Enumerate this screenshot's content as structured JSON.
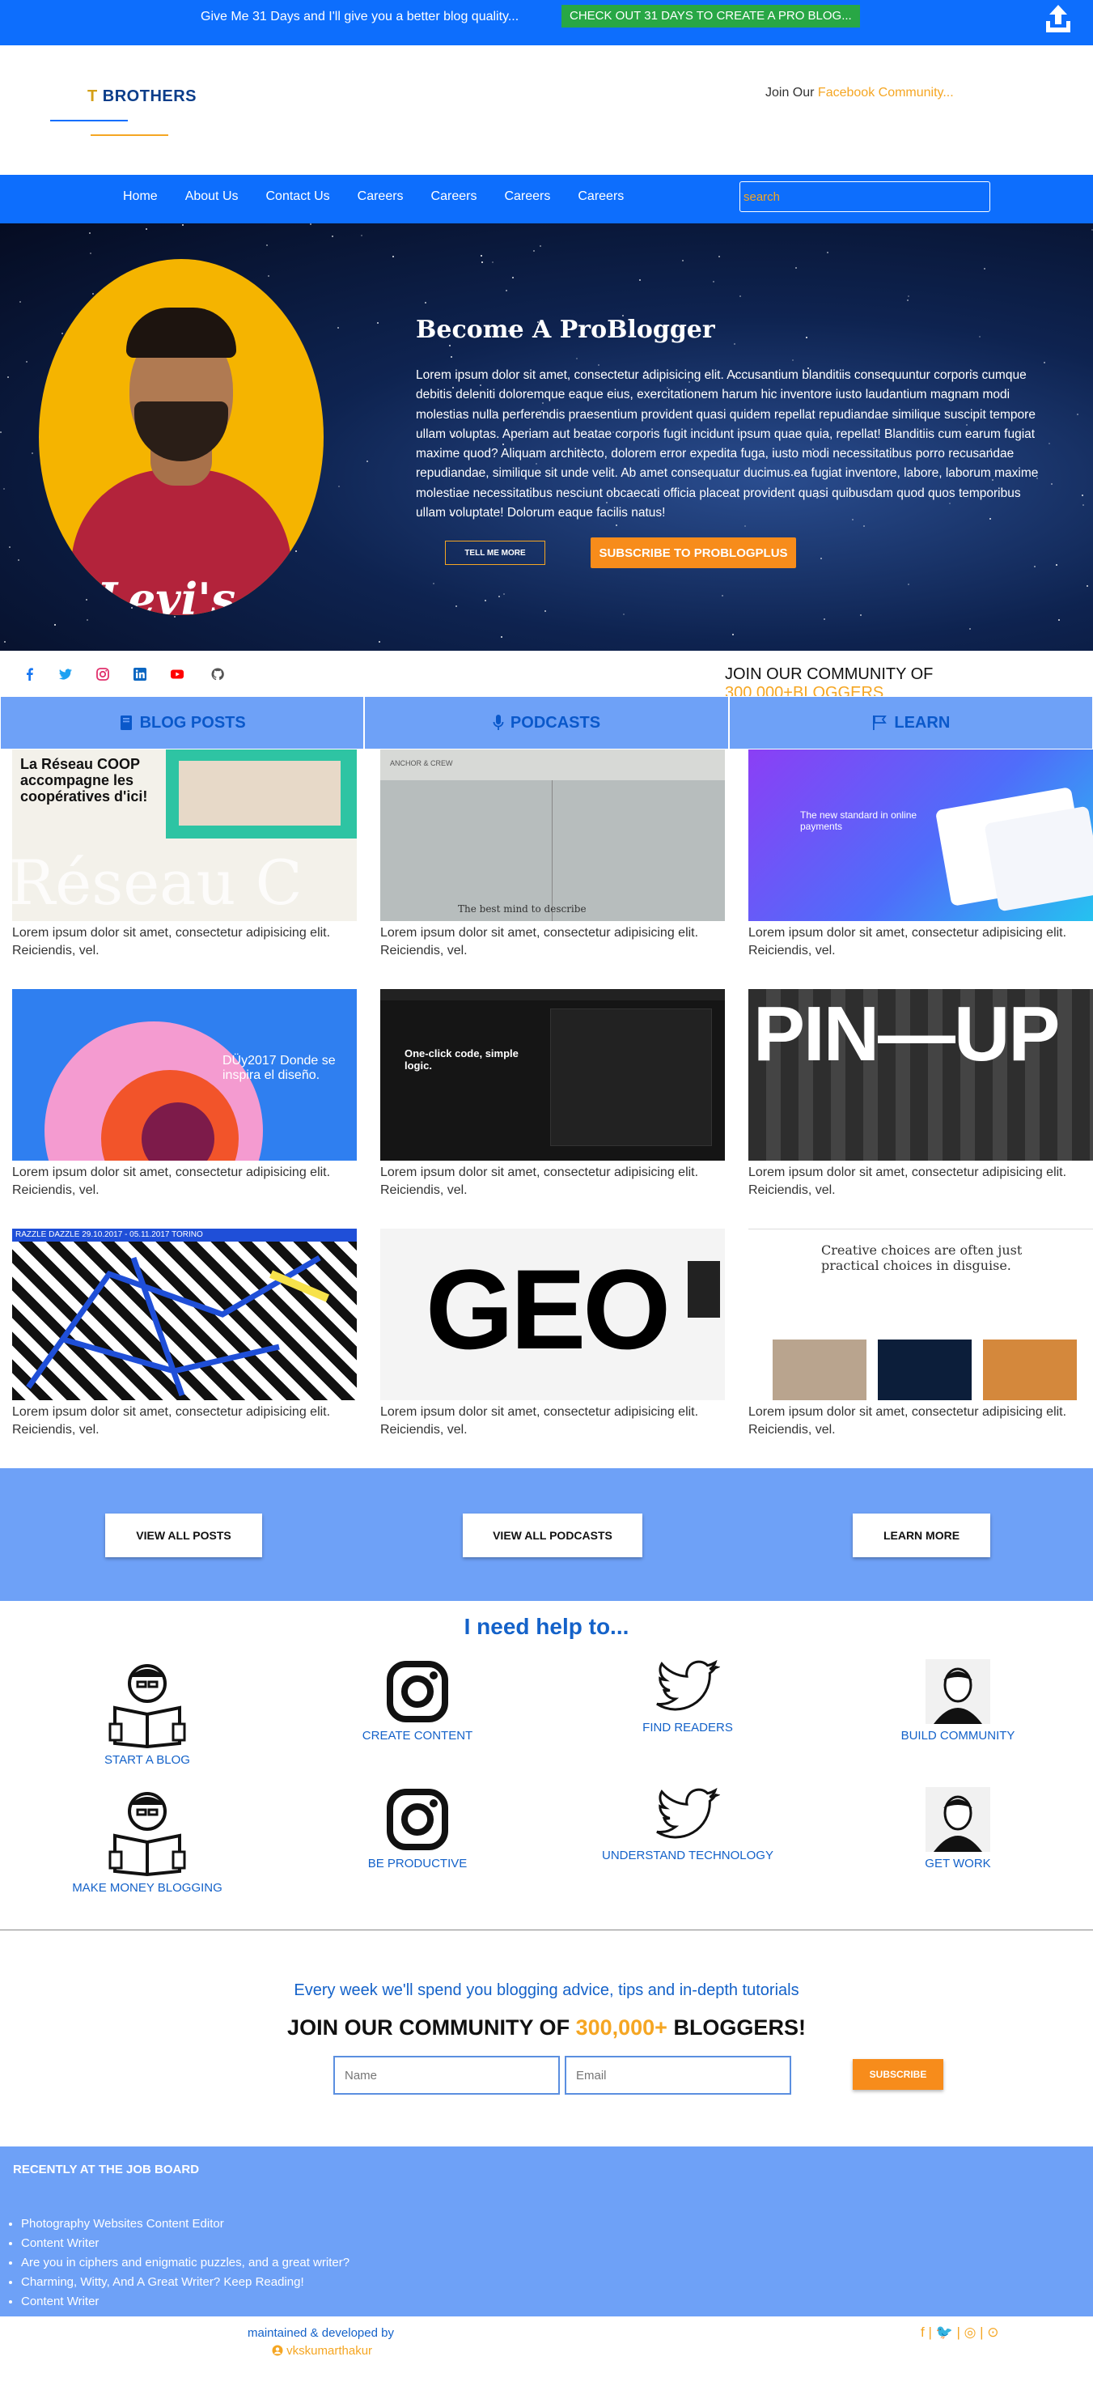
{
  "topbar": {
    "message": "Give Me 31 Days and I'll give you a better blog quality...",
    "cta": "CHECK OUT 31 DAYS TO CREATE A PRO BLOG...",
    "upload_icon": "upload-icon"
  },
  "header": {
    "logo_text": "BROTHERS",
    "join_prefix": "Join Our ",
    "join_link": "Facebook Community..."
  },
  "nav": {
    "items": [
      "Home",
      "About Us",
      "Contact Us",
      "Careers",
      "Careers",
      "Careers",
      "Careers"
    ],
    "search_placeholder": "search"
  },
  "hero": {
    "title": "Become A ProBlogger",
    "text": "Lorem ipsum dolor sit amet, consectetur adipisicing elit. Accusantium blanditiis consequuntur corporis cumque debitis deleniti doloremque eaque eius, exercitationem harum hic inventore iusto laudantium magnam modi molestias nulla perferendis praesentium provident quasi quidem repellat repudiandae similique suscipit tempore ullam voluptas. Aperiam aut beatae corporis fugit incidunt ipsum quae quia, repellat! Blanditiis cum earum fugiat maxime quod? Aliquam architecto, dolorem error expedita fuga, iusto modi necessitatibus porro recusandae repudiandae, similique sit unde velit. Ab amet consequatur ducimus ea fugiat inventore, labore, laborum maxime molestiae necessitatibus nesciunt obcaecati officia placeat provident quasi quibusdam quod quos temporibus ullam voluptate! Dolorum eaque facilis natus!",
    "btn_tell": "TELL ME MORE",
    "btn_subscribe": "SUBSCRIBE TO PROBLOGPLUS"
  },
  "social": {
    "icons": [
      "facebook-icon",
      "twitter-icon",
      "instagram-icon",
      "linkedin-icon",
      "youtube-icon",
      "github-icon"
    ],
    "community_prefix": "JOIN OUR COMMUNITY OF ",
    "community_count": "300,000+",
    "community_suffix": "BLOGGERS"
  },
  "tabs": [
    {
      "label": "BLOG POSTS",
      "icon": "book-icon"
    },
    {
      "label": "PODCASTS",
      "icon": "microphone-icon"
    },
    {
      "label": "LEARN",
      "icon": "flag-icon"
    }
  ],
  "posts": {
    "caption": "Lorem ipsum dolor sit amet, consectetur adipisicing elit. Reiciendis, vel.",
    "thumbs": [
      {
        "text": "La Réseau COOP accompagne les coopératives d'ici!"
      },
      {
        "text": "ANCHOR & CREW"
      },
      {
        "text": "The new standard in online payments"
      },
      {
        "text": "DÜy2017 Donde se inspira el diseño."
      },
      {
        "text": "One-click code, simple logic."
      },
      {
        "text": "PIN—UP"
      },
      {
        "text": "RAZZLE DAZZLE 29.10.2017 - 05.11.2017 TORINO"
      },
      {
        "text": "GEO"
      },
      {
        "text": "Creative choices are often just practical choices in disguise."
      }
    ]
  },
  "band": {
    "view_posts": "VIEW ALL POSTS",
    "view_podcasts": "VIEW ALL PODCASTS",
    "learn_more": "LEARN MORE"
  },
  "help": {
    "title": "I need help to...",
    "items": [
      {
        "label": "START A BLOG",
        "icon": "reader-icon"
      },
      {
        "label": "CREATE CONTENT",
        "icon": "instagram-icon"
      },
      {
        "label": "FIND READERS",
        "icon": "twitter-icon"
      },
      {
        "label": "BUILD COMMUNITY",
        "icon": "person-icon"
      },
      {
        "label": "MAKE MONEY BLOGGING",
        "icon": "reader-icon"
      },
      {
        "label": "BE PRODUCTIVE",
        "icon": "instagram-icon"
      },
      {
        "label": "UNDERSTAND TECHNOLOGY",
        "icon": "twitter-icon"
      },
      {
        "label": "GET WORK",
        "icon": "person-icon"
      }
    ]
  },
  "newsletter": {
    "subtitle": "Every week we'll spend you blogging advice, tips and in-depth tutorials",
    "title_prefix": "JOIN OUR COMMUNITY OF ",
    "title_count": "300,000+",
    "title_suffix": " BLOGGERS!",
    "name_placeholder": "Name",
    "email_placeholder": "Email",
    "subscribe": "SUBSCRIBE"
  },
  "jobs": {
    "title": "RECENTLY AT THE JOB BOARD",
    "items": [
      "Photography Websites Content Editor",
      "Content Writer",
      "Are you in ciphers and enigmatic puzzles, and a great writer?",
      "Charming, Witty, And A Great Writer? Keep Reading!",
      "Content Writer"
    ]
  },
  "footer": {
    "line1": "maintained & developed by",
    "author": "vkskumarthakur",
    "icons": "f | 🐦 | ◎ | ⊙"
  },
  "colors": {
    "primary": "#0d6efd",
    "light_blue": "#6ea1f7",
    "orange": "#f5a623",
    "green": "#28a745"
  }
}
